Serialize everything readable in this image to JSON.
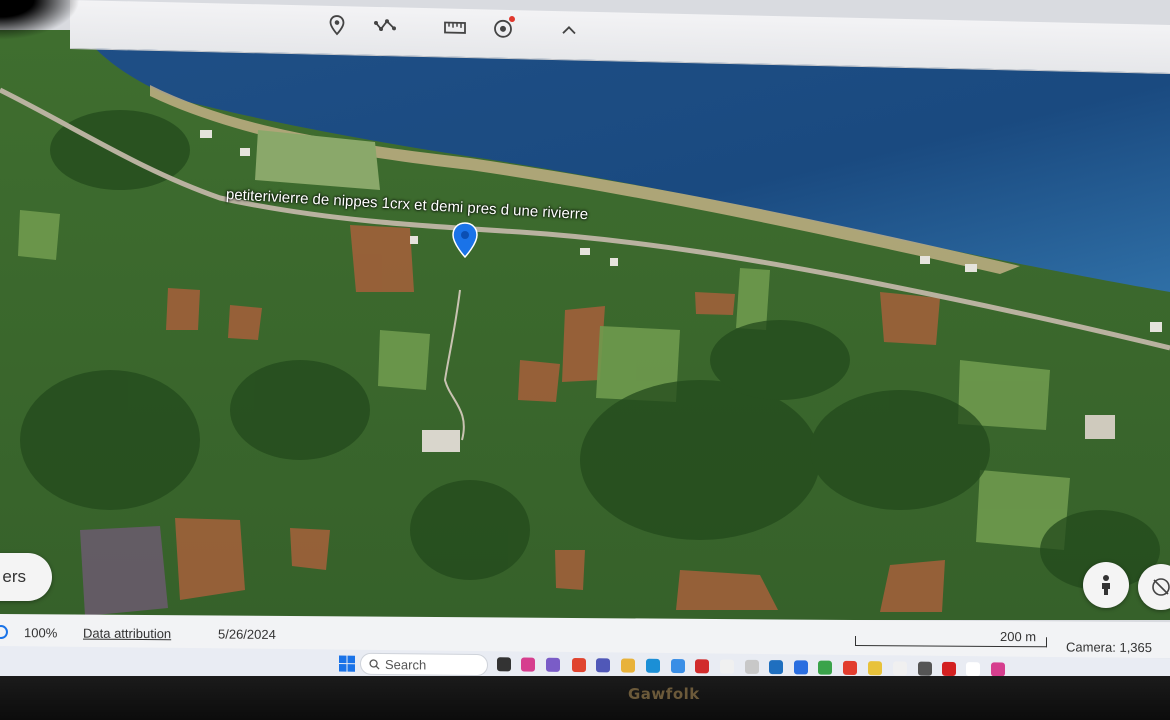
{
  "toolbar": {
    "buttons": [
      {
        "name": "add-placemark",
        "icon": "map-pin-icon"
      },
      {
        "name": "add-path",
        "icon": "path-icon"
      },
      {
        "name": "measure",
        "icon": "ruler-icon"
      },
      {
        "name": "record-tour",
        "icon": "record-icon"
      },
      {
        "name": "collapse",
        "icon": "chevron-up-icon"
      }
    ]
  },
  "map": {
    "place_label": "petiterivierre de nippes 1crx et demi pres d une rivierre",
    "layers_button_label": "ers",
    "pegman_icon": "pegman-icon",
    "compass_icon": "compass-icon"
  },
  "status": {
    "zoom": "100%",
    "data_attribution": "Data attribution",
    "date": "5/26/2024",
    "scale": "200 m",
    "camera": "Camera: 1,365"
  },
  "taskbar": {
    "search_placeholder": "Search"
  },
  "monitor": {
    "brand": "Gawfolk"
  }
}
